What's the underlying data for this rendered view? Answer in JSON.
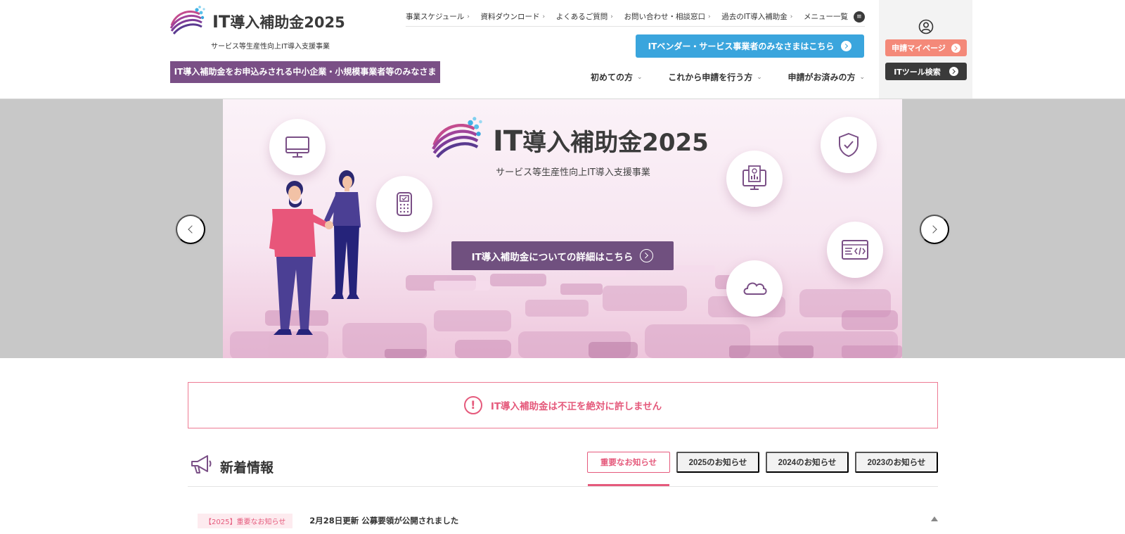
{
  "header": {
    "logo_title": "導入補助金2025",
    "logo_title_prefix": "IT",
    "logo_subtitle": "サービス等生産性向上IT導入支援事業",
    "sme_banner": "IT導入補助金をお申込みされる中小企業・小規模事業者等のみなさま",
    "top_links": [
      {
        "label": "事業スケジュール"
      },
      {
        "label": "資料ダウンロード"
      },
      {
        "label": "よくあるご質問"
      },
      {
        "label": "お問い合わせ・相談窓口"
      },
      {
        "label": "過去のIT導入補助金"
      },
      {
        "label": "メニュー一覧"
      }
    ],
    "vendor_button": "ITベンダー・サービス事業者のみなさまはこちら",
    "main_nav": [
      {
        "label": "初めての方"
      },
      {
        "label": "これから申請を行う方"
      },
      {
        "label": "申請がお済みの方"
      }
    ],
    "side": {
      "mypage_button": "申請マイページ",
      "tool_button": "ITツール検索"
    }
  },
  "hero": {
    "title_prefix": "IT",
    "title": "導入補助金2025",
    "subtitle": "サービス等生産性向上IT導入支援事業",
    "cta": "IT導入補助金についての詳細はこちら"
  },
  "notice": {
    "icon": "!",
    "text": "IT導入補助金は不正を絶対に許しません"
  },
  "news": {
    "title": "新着情報",
    "tabs": [
      {
        "label": "重要なお知らせ",
        "active": true
      },
      {
        "label": "2025のお知らせ"
      },
      {
        "label": "2024のお知らせ"
      },
      {
        "label": "2023のお知らせ"
      }
    ],
    "items": [
      {
        "badge": "【2025】重要なお知らせ",
        "text": "2月28日更新 公募要領が公開されました"
      }
    ]
  },
  "colors": {
    "brand_purple": "#7a4f86",
    "vendor_blue": "#3aa5dd",
    "mypage_salmon": "#f48979",
    "alert_pink": "#e55a7c"
  }
}
